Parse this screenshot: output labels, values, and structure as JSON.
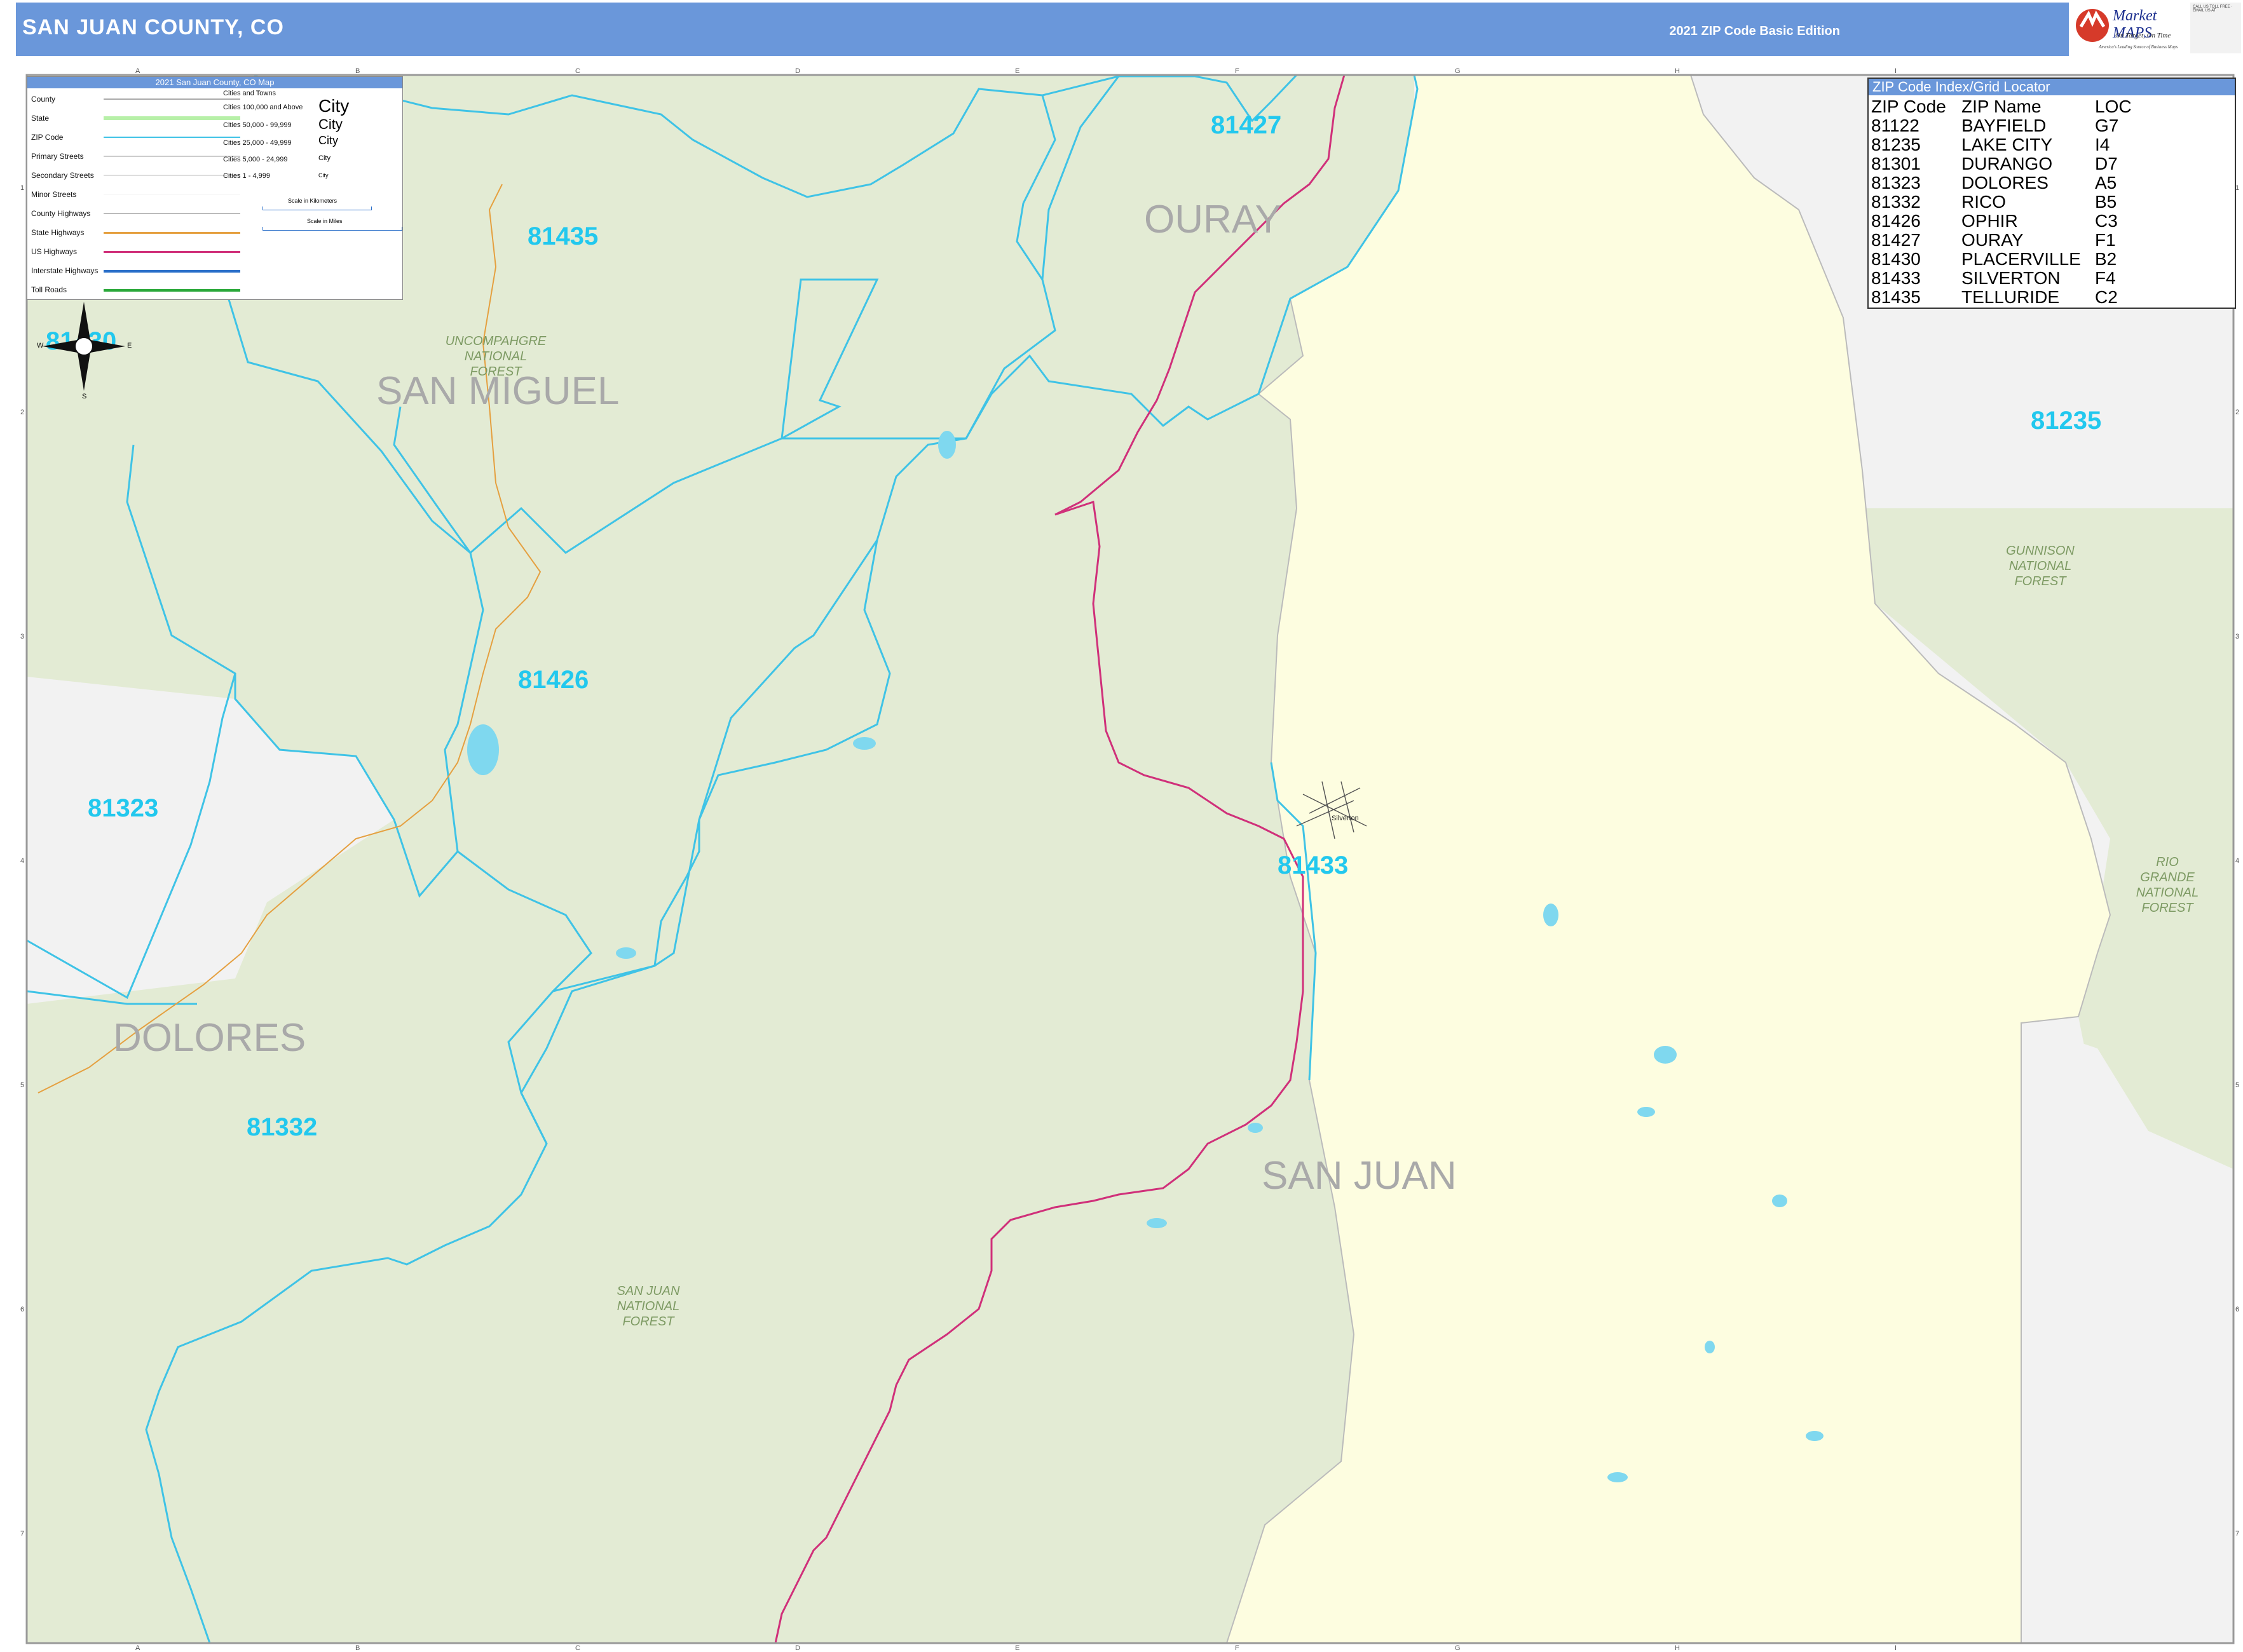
{
  "header": {
    "title": "SAN JUAN COUNTY, CO",
    "edition": "2021 ZIP Code Basic Edition",
    "logo_text": "Market MAPS",
    "logo_tagline": "On Target, On Time",
    "logo_subtitle": "America's Leading Source of Business Maps",
    "contact_text": "CALL US TOLL FREE · EMAIL US AT"
  },
  "counties": [
    "OURAY",
    "SAN MIGUEL",
    "DOLORES",
    "SAN JUAN"
  ],
  "zip_labels": [
    "81427",
    "81435",
    "81235",
    "81426",
    "81323",
    "81433",
    "81332",
    "81430"
  ],
  "forests": {
    "uncompahgre": [
      "UNCOMPAHGRE",
      "NATIONAL",
      "FOREST"
    ],
    "gunnison": [
      "GUNNISON",
      "NATIONAL",
      "FOREST"
    ],
    "rio_grande": [
      "RIO",
      "GRANDE",
      "NATIONAL",
      "FOREST"
    ],
    "san_juan": [
      "SAN JUAN",
      "NATIONAL",
      "FOREST"
    ]
  },
  "city": "Silverton",
  "compass": {
    "n": "N",
    "s": "S",
    "e": "E",
    "w": "W"
  },
  "legend": {
    "title": "2021 San Juan County, CO Map",
    "items": [
      "County",
      "State",
      "ZIP Code",
      "Primary Streets",
      "Secondary Streets",
      "Minor Streets",
      "County Highways",
      "State Highways",
      "US Highways",
      "Interstate Highways",
      "Toll Roads"
    ],
    "cities_header": "Cities and Towns",
    "city_classes": [
      "Cities 100,000 and Above",
      "Cities 50,000 - 99,999",
      "Cities 25,000 - 49,999",
      "Cities 5,000 - 24,999",
      "Cities 1 - 4,999"
    ],
    "city_samples": [
      "City",
      "City",
      "City",
      "City",
      "City"
    ],
    "scale_km": "Scale in Kilometers",
    "scale_mi": "Scale in Miles"
  },
  "zip_index": {
    "title": "ZIP Code Index/Grid Locator",
    "headers": [
      "ZIP Code",
      "ZIP Name",
      "LOC"
    ],
    "rows": [
      [
        "81122",
        "BAYFIELD",
        "G7"
      ],
      [
        "81235",
        "LAKE CITY",
        "I4"
      ],
      [
        "81301",
        "DURANGO",
        "D7"
      ],
      [
        "81323",
        "DOLORES",
        "A5"
      ],
      [
        "81332",
        "RICO",
        "B5"
      ],
      [
        "81426",
        "OPHIR",
        "C3"
      ],
      [
        "81427",
        "OURAY",
        "F1"
      ],
      [
        "81430",
        "PLACERVILLE",
        "B2"
      ],
      [
        "81433",
        "SILVERTON",
        "F4"
      ],
      [
        "81435",
        "TELLURIDE",
        "C2"
      ]
    ]
  },
  "grid": {
    "columns": [
      "A",
      "B",
      "C",
      "D",
      "E",
      "F",
      "G",
      "H",
      "I"
    ],
    "rows": [
      "1",
      "2",
      "3",
      "4",
      "5",
      "6",
      "7"
    ]
  },
  "colors": {
    "header": "#6a97da",
    "forest": "#e3ebd4",
    "san_juan_county": "#fdfde0",
    "outside": "#f2f2f2",
    "zip_boundary": "#3fc3e6",
    "us_highway": "#d0307a",
    "county_highway": "#e5a040"
  }
}
